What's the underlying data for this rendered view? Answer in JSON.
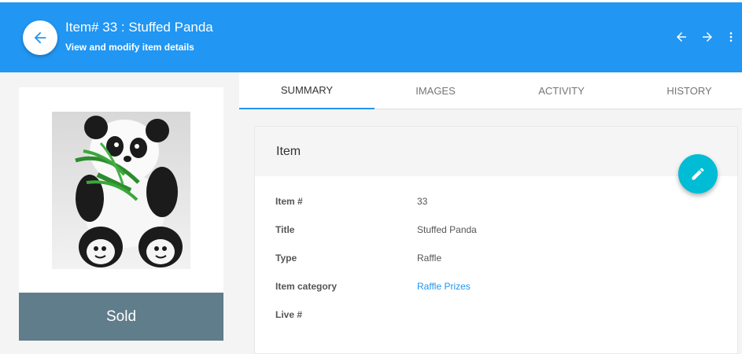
{
  "header": {
    "title": "Item# 33 : Stuffed Panda",
    "subtitle": "View and modify item details"
  },
  "item": {
    "status": "Sold",
    "image_alt": "Stuffed panda toy holding bamboo"
  },
  "tabs": [
    {
      "label": "SUMMARY",
      "active": true
    },
    {
      "label": "IMAGES",
      "active": false
    },
    {
      "label": "ACTIVITY",
      "active": false
    },
    {
      "label": "HISTORY",
      "active": false
    }
  ],
  "card": {
    "title": "Item",
    "fields": [
      {
        "label": "Item #",
        "value": "33"
      },
      {
        "label": "Title",
        "value": "Stuffed Panda"
      },
      {
        "label": "Type",
        "value": "Raffle"
      },
      {
        "label": "Item category",
        "value": "Raffle Prizes",
        "link": true
      },
      {
        "label": "Live #",
        "value": ""
      }
    ]
  },
  "colors": {
    "header": "#2196f3",
    "status_bar": "#607d8b",
    "fab": "#00bcd4",
    "link": "#2196f3"
  },
  "icons": {
    "back": "arrow-left-icon",
    "prev": "arrow-left-icon",
    "next": "arrow-right-icon",
    "menu": "more-vertical-icon",
    "edit": "pencil-icon"
  }
}
